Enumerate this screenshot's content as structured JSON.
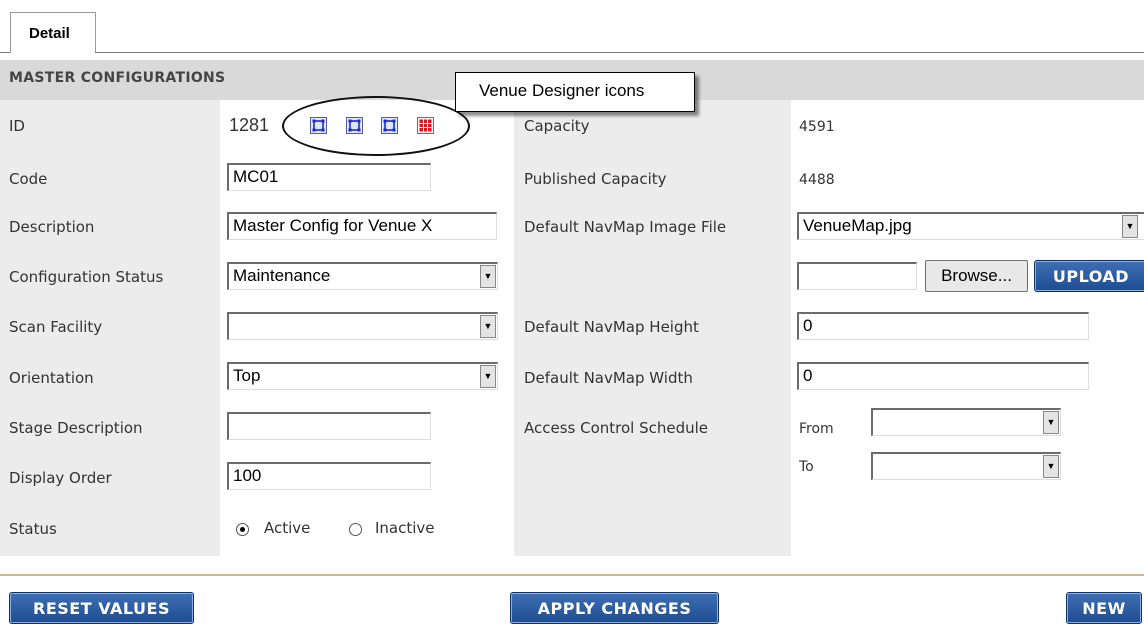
{
  "tab": {
    "label": "Detail"
  },
  "section": {
    "title": "MASTER CONFIGURATIONS"
  },
  "callout": {
    "text": "Venue Designer icons"
  },
  "left": {
    "id": {
      "label": "ID",
      "value": "1281"
    },
    "code": {
      "label": "Code",
      "value": "MC01"
    },
    "description": {
      "label": "Description",
      "value": "Master Config for Venue X"
    },
    "configuration_status": {
      "label": "Configuration Status",
      "value": "Maintenance"
    },
    "scan_facility": {
      "label": "Scan Facility",
      "value": ""
    },
    "orientation": {
      "label": "Orientation",
      "value": "Top"
    },
    "stage_description": {
      "label": "Stage Description",
      "value": ""
    },
    "display_order": {
      "label": "Display Order",
      "value": "100"
    },
    "status": {
      "label": "Status",
      "active_label": "Active",
      "inactive_label": "Inactive",
      "selected": "Active"
    }
  },
  "right": {
    "capacity": {
      "label": "Capacity",
      "value": "4591"
    },
    "published_capacity": {
      "label": "Published Capacity",
      "value": "4488"
    },
    "navmap_image": {
      "label": "Default NavMap Image File",
      "value": "VenueMap.jpg"
    },
    "upload": {
      "browse_label": "Browse...",
      "upload_label": "UPLOAD"
    },
    "navmap_height": {
      "label": "Default NavMap Height",
      "value": "0"
    },
    "navmap_width": {
      "label": "Default NavMap Width",
      "value": "0"
    },
    "access_control": {
      "label": "Access Control Schedule",
      "from_label": "From",
      "to_label": "To"
    }
  },
  "buttons": {
    "reset": "RESET VALUES",
    "apply": "APPLY CHANGES",
    "new": "NEW"
  },
  "icons": [
    "venue-designer-icon-1",
    "venue-designer-icon-2",
    "venue-designer-icon-3",
    "venue-grid-icon"
  ],
  "colors": {
    "button_blue": "#1e4c91",
    "header_gray": "#d9d9d9",
    "label_bg": "#ececec"
  }
}
